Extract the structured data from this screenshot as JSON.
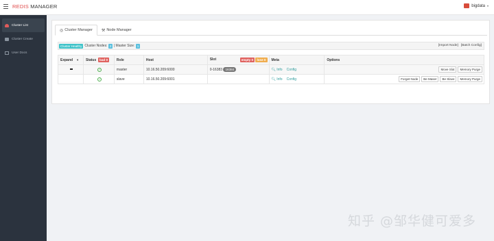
{
  "header": {
    "brand_part1": "REDIS",
    "brand_part2": " MANAGER",
    "user": "bigdata",
    "caret": "▾"
  },
  "sidebar": {
    "items": [
      {
        "label": "Cluster List",
        "icon": "cloud-icon"
      },
      {
        "label": "Cluster Create",
        "icon": "create-icon"
      },
      {
        "label": "User Docs",
        "icon": "docs-icon"
      }
    ]
  },
  "tabs": [
    {
      "label": "Cluster Manager",
      "icon": "cluster-icon",
      "active": true
    },
    {
      "label": "Node Manager",
      "icon": "wrench-icon",
      "active": false
    }
  ],
  "status_bar": {
    "healthy": "Cluster Healthy",
    "nodes_label": "Cluster Nodes:",
    "nodes_value": "2",
    "separator": "|",
    "master_label": "Master Size:",
    "master_value": "1",
    "import_node": "[Import Node]",
    "batch_config": "[Batch Config]"
  },
  "table": {
    "headers": {
      "expand": "Expand",
      "status": "Status",
      "status_badge": "bad 0",
      "role": "Role",
      "host": "Host",
      "slot": "Slot",
      "slot_empty_badge": "empty 0",
      "slot_lose_badge": "lose 0",
      "meta": "Meta",
      "options": "Options"
    },
    "rows": [
      {
        "role": "master",
        "host": "10.16.50.209:6000",
        "slot": "0-16383",
        "slot_count": "16384",
        "info": "Info",
        "config": "Config",
        "buttons": [
          "Move Slot",
          "Memory Purge"
        ]
      },
      {
        "role": "slave",
        "host": "10.16.50.209:6001",
        "slot": "",
        "slot_count": "",
        "info": "Info",
        "config": "Config",
        "buttons": [
          "Forget Node",
          "Be Maser",
          "Be Slave",
          "Memory Purge"
        ]
      }
    ]
  },
  "watermark": "知乎 @邹华健可爱多",
  "colors": {
    "brand_red": "#e04848",
    "sidebar_bg": "#2b333e",
    "healthy": "#3fc3c9",
    "link": "#2e9c9c"
  }
}
